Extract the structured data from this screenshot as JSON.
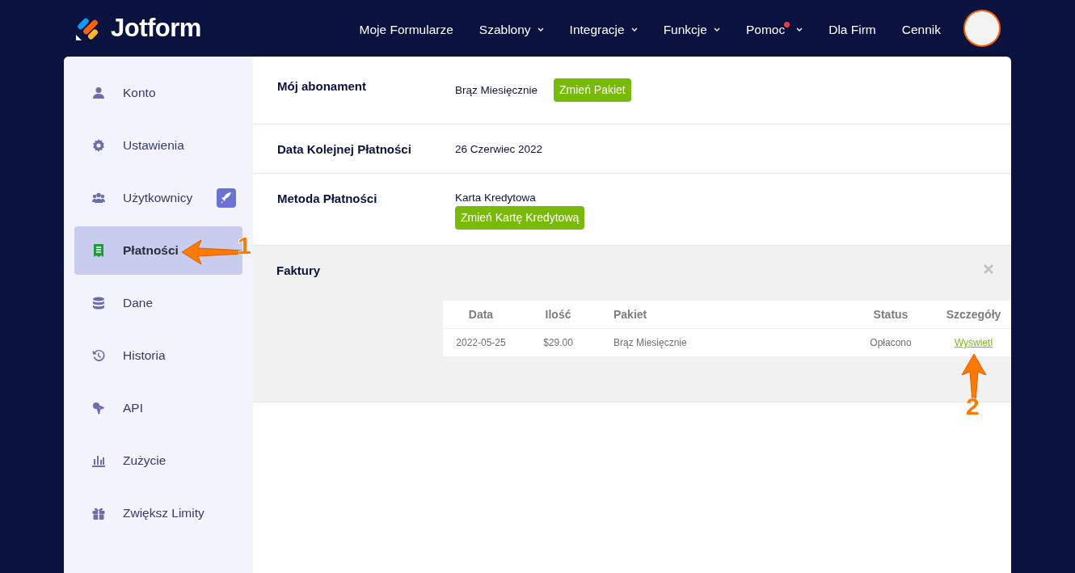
{
  "brand": {
    "name": "Jotform"
  },
  "nav": [
    {
      "label": "Moje Formularze",
      "dropdown": false,
      "notification": false
    },
    {
      "label": "Szablony",
      "dropdown": true,
      "notification": false
    },
    {
      "label": "Integracje",
      "dropdown": true,
      "notification": false
    },
    {
      "label": "Funkcje",
      "dropdown": true,
      "notification": false
    },
    {
      "label": "Pomoc",
      "dropdown": true,
      "notification": true
    },
    {
      "label": "Dla Firm",
      "dropdown": false,
      "notification": false
    },
    {
      "label": "Cennik",
      "dropdown": false,
      "notification": false
    }
  ],
  "sidebar": {
    "items": [
      {
        "label": "Konto",
        "selected": false,
        "upgrade_badge": false
      },
      {
        "label": "Ustawienia",
        "selected": false,
        "upgrade_badge": false
      },
      {
        "label": "Użytkownicy",
        "selected": false,
        "upgrade_badge": true
      },
      {
        "label": "Płatności",
        "selected": true,
        "upgrade_badge": false
      },
      {
        "label": "Dane",
        "selected": false,
        "upgrade_badge": false
      },
      {
        "label": "Historia",
        "selected": false,
        "upgrade_badge": false
      },
      {
        "label": "API",
        "selected": false,
        "upgrade_badge": false
      },
      {
        "label": "Zużycie",
        "selected": false,
        "upgrade_badge": false
      },
      {
        "label": "Zwiększ Limity",
        "selected": false,
        "upgrade_badge": false
      }
    ]
  },
  "billing": [
    {
      "label": "Mój abonament",
      "value": "Brąz Miesięcznie",
      "button": "Zmień Pakiet",
      "kind": "inline"
    },
    {
      "label": "Data Kolejnej Płatności",
      "value": "26 Czerwiec 2022",
      "kind": "plain"
    },
    {
      "label": "Metoda Płatności",
      "value": "Karta Kredytowa",
      "button": "Zmień Kartę Kredytową",
      "kind": "stacked"
    }
  ],
  "invoices": {
    "title": "Faktury",
    "columns": [
      "Data",
      "Ilość",
      "Pakiet",
      "Status",
      "Szczegóły"
    ],
    "rows": [
      {
        "date": "2022-05-25",
        "amount": "$29.00",
        "plan": "Brąz Miesięcznie",
        "status": "Opłacono",
        "link": "Wyświetl"
      }
    ]
  },
  "annotations": [
    {
      "number": "1"
    },
    {
      "number": "2"
    }
  ]
}
